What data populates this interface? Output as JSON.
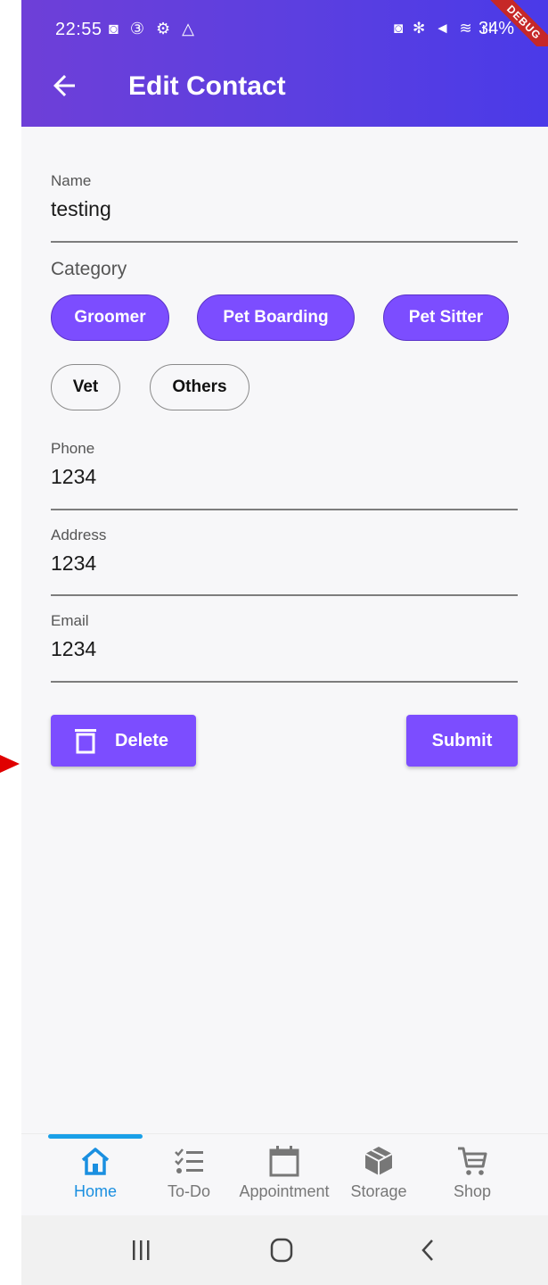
{
  "status_bar": {
    "time": "22:55",
    "battery": "34%",
    "debug_label": "DEBUG",
    "left_icons": "◙ ③ ⚙ △",
    "right_icons": "◙ ✻ ◄ ≋ ıl"
  },
  "app_bar": {
    "title": "Edit Contact",
    "back_icon": "arrow-left-icon"
  },
  "form": {
    "name": {
      "label": "Name",
      "value": "testing"
    },
    "category_label": "Category",
    "categories": [
      {
        "label": "Groomer",
        "selected": true
      },
      {
        "label": "Pet Boarding",
        "selected": true
      },
      {
        "label": "Pet Sitter",
        "selected": true
      },
      {
        "label": "Vet",
        "selected": false
      },
      {
        "label": "Others",
        "selected": false
      }
    ],
    "phone": {
      "label": "Phone",
      "value": "1234"
    },
    "address": {
      "label": "Address",
      "value": "1234"
    },
    "email": {
      "label": "Email",
      "value": "1234"
    }
  },
  "actions": {
    "delete_label": "Delete",
    "submit_label": "Submit"
  },
  "bottom_nav": {
    "items": [
      {
        "label": "Home",
        "icon": "home-icon",
        "active": true
      },
      {
        "label": "To-Do",
        "icon": "checklist-icon",
        "active": false
      },
      {
        "label": "Appointment",
        "icon": "calendar-icon",
        "active": false
      },
      {
        "label": "Storage",
        "icon": "box-icon",
        "active": false
      },
      {
        "label": "Shop",
        "icon": "cart-icon",
        "active": false
      }
    ]
  },
  "colors": {
    "accent": "#7c4dff",
    "appbar_start": "#6e3fd8",
    "appbar_end": "#4a3ae8",
    "nav_active": "#1a8fe0"
  }
}
